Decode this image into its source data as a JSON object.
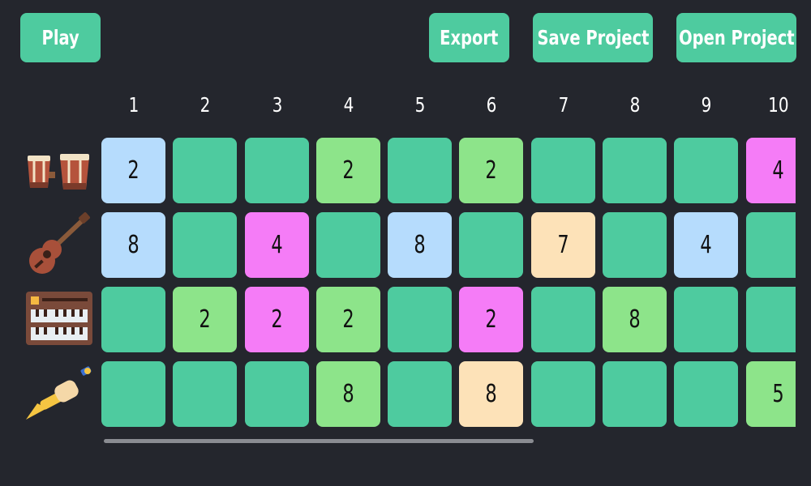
{
  "toolbar": {
    "play_label": "Play",
    "export_label": "Export",
    "save_label": "Save Project",
    "open_label": "Open Project"
  },
  "columns": [
    "1",
    "2",
    "3",
    "4",
    "5",
    "6",
    "7",
    "8",
    "9",
    "10"
  ],
  "instruments": [
    {
      "name": "bongo-drums-icon"
    },
    {
      "name": "ukulele-icon"
    },
    {
      "name": "keyboard-synth-icon"
    },
    {
      "name": "trumpet-icon"
    }
  ],
  "rows": [
    [
      "2",
      "",
      "",
      "2",
      "",
      "2",
      "",
      "",
      "",
      "4"
    ],
    [
      "8",
      "",
      "4",
      "",
      "8",
      "",
      "7",
      "",
      "4",
      ""
    ],
    [
      "",
      "2",
      "2",
      "2",
      "",
      "2",
      "",
      "8",
      "",
      ""
    ],
    [
      "",
      "",
      "",
      "8",
      "",
      "8",
      "",
      "",
      "",
      "5"
    ]
  ],
  "value_colors": {
    "": "#4ecb9f",
    "2": "#8de48a",
    "4": "#f57cf7",
    "5": "#8de48a",
    "7": "#fde2b8",
    "8": "#b6dcfd"
  },
  "overrides": {
    "0-0": "#b6dcfd",
    "3-5": "#fde2b8",
    "2-3": "#8de48a",
    "1-2": "#f57cf7",
    "2-2": "#f57cf7",
    "2-5": "#f57cf7",
    "2-7": "#8de48a",
    "3-3": "#8de48a",
    "1-8": "#b6dcfd"
  },
  "colors": {
    "background": "#24262d",
    "accent": "#4ecb9f"
  }
}
